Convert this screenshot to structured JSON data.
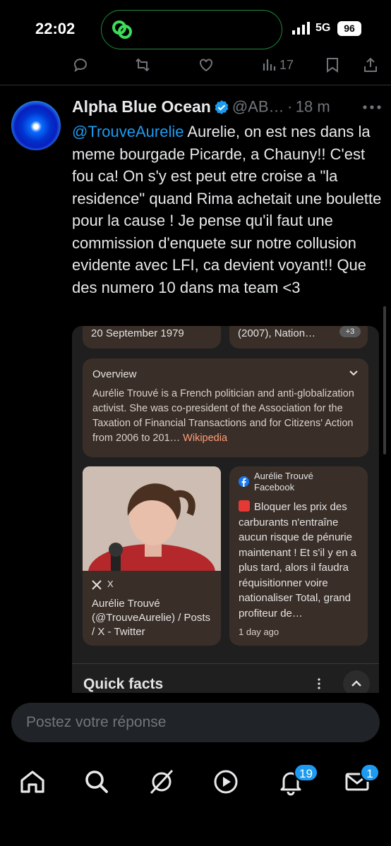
{
  "status_bar": {
    "time": "22:02",
    "network": "5G",
    "battery": "96"
  },
  "prev_tweet": {
    "views": "17"
  },
  "tweet": {
    "author": "Alpha Blue Ocean",
    "handle": "@AB…",
    "separator": "·",
    "time": "18 m",
    "mention": "@TrouveAurelie",
    "text": " Aurelie, on est nes dans la meme bourgade Picarde, a Chauny!! C'est fou ca! On s'y est peut etre croise a \"la residence\" quand Rima achetait une boulette pour la cause ! Je pense qu'il faut une commission d'enquete sur notre collusion evidente avec LFI, ca devient voyant!! Que des numero 10 dans ma team <3"
  },
  "media": {
    "birth_date": "20 September 1979",
    "works": "(2007), Nation…",
    "more_count": "+3",
    "overview": {
      "title": "Overview",
      "body": "Aurélie Trouvé is a French politician and anti-globalization activist. She was co-president of the Association for the Taxation of Financial Transactions and for Citizens' Action from 2006 to 201…",
      "link": "Wikipedia"
    },
    "x_card": {
      "source": "X",
      "title": "Aurélie Trouvé (@TrouveAurelie) / Posts / X - Twitter"
    },
    "fb_card": {
      "name": "Aurélie Trouvé",
      "source": "Facebook",
      "post": "Bloquer les prix des carburants n'entraîne aucun risque de pénurie maintenant ! Et s'il y en a plus tard, alors il faudra réquisitionner voire nationaliser Total, grand profiteur de…",
      "time": "1 day ago"
    },
    "quick_facts": "Quick facts"
  },
  "reply": {
    "placeholder": "Postez votre réponse"
  },
  "nav": {
    "notifications_badge": "19",
    "messages_badge": "1"
  },
  "colors": {
    "accent": "#1d9bf0",
    "background": "#000000",
    "card": "#3a2e28",
    "muted": "#71767b"
  },
  "icons": [
    "reply-icon",
    "retweet-icon",
    "like-icon",
    "views-icon",
    "bookmark-icon",
    "share-icon",
    "verified-icon",
    "more-icon",
    "home-icon",
    "search-icon",
    "grok-icon",
    "video-icon",
    "notifications-icon",
    "messages-icon"
  ]
}
